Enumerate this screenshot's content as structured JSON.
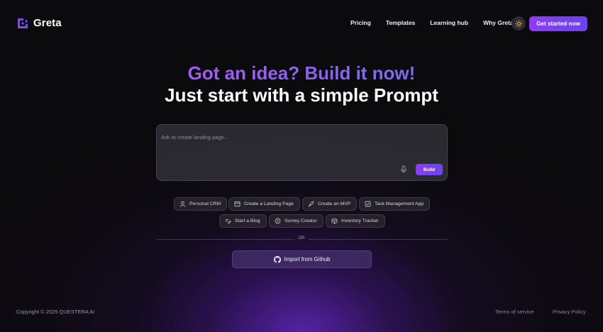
{
  "brand": {
    "name": "Greta"
  },
  "nav": {
    "items": [
      {
        "label": "Pricing"
      },
      {
        "label": "Templates"
      },
      {
        "label": "Learning hub"
      },
      {
        "label": "Why Greta?"
      }
    ],
    "theme_icon": "sun-icon",
    "cta_label": "Get started now"
  },
  "hero": {
    "headline": "Got an idea? Build it now!",
    "subheadline": "Just start with a simple Prompt"
  },
  "prompt": {
    "placeholder": "Ask to create landing page...",
    "value": "",
    "mic_icon": "microphone-icon",
    "build_label": "Build"
  },
  "suggestions": [
    {
      "label": "Personal CRM",
      "icon": "user-icon"
    },
    {
      "label": "Create a Landing Page",
      "icon": "window-icon"
    },
    {
      "label": "Create an MVP",
      "icon": "rocket-icon"
    },
    {
      "label": "Task Management App",
      "icon": "checklist-icon"
    },
    {
      "label": "Start a Blog",
      "icon": "edit-text-icon"
    },
    {
      "label": "Survey Creator",
      "icon": "poll-icon"
    },
    {
      "label": "Inventory Tracker",
      "icon": "box-icon"
    }
  ],
  "divider_text": "OR",
  "import": {
    "label": "Import from Github",
    "icon": "github-icon"
  },
  "footer": {
    "copyright": "Copyright © 2025 QUESTERA AI",
    "links": [
      {
        "label": "Terms of service"
      },
      {
        "label": "Privacy Policy"
      }
    ]
  },
  "colors": {
    "accent": "#8b3df5",
    "accent_secondary": "#6a43f0",
    "background": "#0b0a0d",
    "glow": "#6226be"
  }
}
